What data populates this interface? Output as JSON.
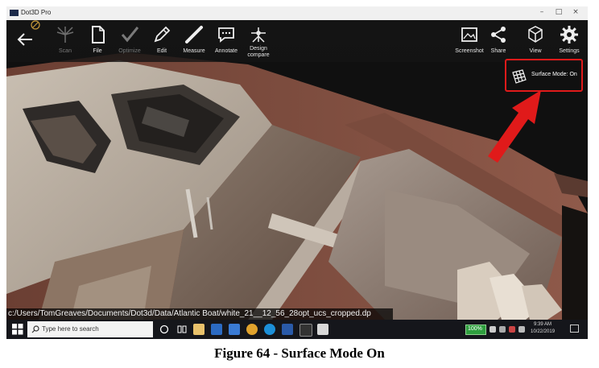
{
  "window": {
    "title": "Dot3D Pro",
    "controls": {
      "minimize": "–",
      "maximize": "□",
      "close": "×"
    }
  },
  "toolbar": {
    "left": [
      {
        "id": "scan",
        "label": "Scan",
        "icon": "scan-icon",
        "enabled": false
      },
      {
        "id": "file",
        "label": "File",
        "icon": "file-icon",
        "enabled": true
      },
      {
        "id": "optimize",
        "label": "Optimize",
        "icon": "checkmark-icon",
        "enabled": false
      },
      {
        "id": "edit",
        "label": "Edit",
        "icon": "pencil-icon",
        "enabled": true
      },
      {
        "id": "measure",
        "label": "Measure",
        "icon": "ruler-icon",
        "enabled": true
      },
      {
        "id": "annotate",
        "label": "Annotate",
        "icon": "speech-bubble-icon",
        "enabled": true
      },
      {
        "id": "design_compare",
        "label": "Design compare",
        "icon": "design-compare-icon",
        "enabled": true
      }
    ],
    "right": [
      {
        "id": "screenshot",
        "label": "Screenshot",
        "icon": "screenshot-icon"
      },
      {
        "id": "share",
        "label": "Share",
        "icon": "share-icon"
      },
      {
        "id": "view",
        "label": "View",
        "icon": "cube-view-icon"
      },
      {
        "id": "settings",
        "label": "Settings",
        "icon": "gear-icon"
      }
    ]
  },
  "status": {
    "surface_mode": "Surface Mode: On",
    "icon": "surface-mesh-icon"
  },
  "file_path": "c:/Users/TomGreaves/Documents/Dot3d/Data/Atlantic Boat/white_21__12_56_28opt_ucs_cropped.dp",
  "annotation": {
    "highlight_color": "#e01a1a"
  },
  "taskbar": {
    "search_placeholder": "Type here to search",
    "battery": "100%",
    "time": "9:39 AM",
    "date": "10/22/2019"
  },
  "caption": "Figure 64 - Surface Mode On"
}
